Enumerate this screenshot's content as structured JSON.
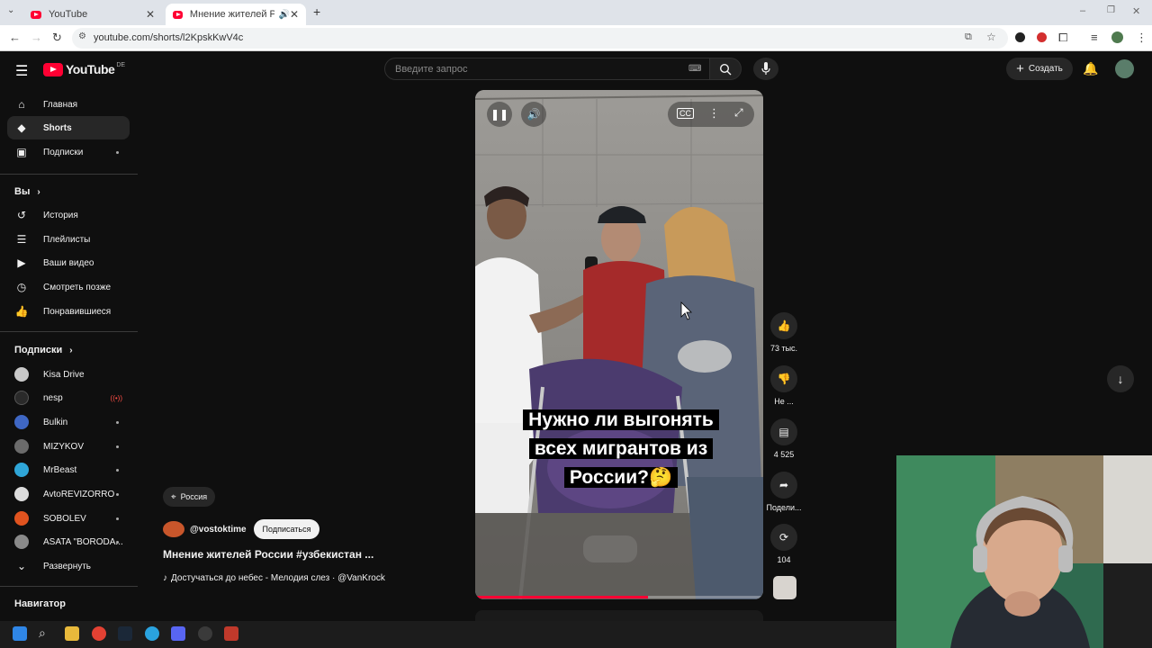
{
  "browser": {
    "tabs": [
      {
        "title": "YouTube",
        "active": false
      },
      {
        "title": "Мнение жителей России #узбекистан …",
        "active": true
      }
    ],
    "url": "youtube.com/shorts/l2KpskKwV4c"
  },
  "topbar": {
    "logo_text": "YouTube",
    "country_code": "DE",
    "search_placeholder": "Введите запрос",
    "create_label": "Создать"
  },
  "sidebar": {
    "main": [
      {
        "label": "Главная",
        "icon": "home-icon"
      },
      {
        "label": "Shorts",
        "icon": "shorts-icon",
        "active": true
      },
      {
        "label": "Подписки",
        "icon": "subscriptions-icon",
        "dot": true
      }
    ],
    "you_header": "Вы",
    "you": [
      {
        "label": "История",
        "icon": "history-icon"
      },
      {
        "label": "Плейлисты",
        "icon": "playlists-icon"
      },
      {
        "label": "Ваши видео",
        "icon": "your-videos-icon"
      },
      {
        "label": "Смотреть позже",
        "icon": "watch-later-icon"
      },
      {
        "label": "Понравившиеся",
        "icon": "liked-icon"
      }
    ],
    "subs_header": "Подписки",
    "subscriptions": [
      {
        "label": "Kisa Drive",
        "color": "#c9c9c9",
        "dot": false
      },
      {
        "label": "nesp",
        "color": "#2a2a2a",
        "live": true
      },
      {
        "label": "Bulkin",
        "color": "#3f67c4",
        "dot": true
      },
      {
        "label": "MIZYKOV",
        "color": "#6b6b6b",
        "dot": true
      },
      {
        "label": "MrBeast",
        "color": "#2fa6d8",
        "dot": true
      },
      {
        "label": "AvtoREVIZORRO",
        "color": "#dcdcdc",
        "dot": true
      },
      {
        "label": "SOBOLEV",
        "color": "#e0531f",
        "dot": true
      },
      {
        "label": "ASATA \"BORODA...",
        "color": "#8a8a8a",
        "dot": true
      }
    ],
    "expand_label": "Развернуть",
    "navigator_header": "Навигатор"
  },
  "short": {
    "location": "Россия",
    "channel": "@vostoktime",
    "subscribe_label": "Подписаться",
    "title": "Мнение жителей России #узбекистан ...",
    "music": "Достучаться до небес - Мелодия слез · @VanKrock",
    "caption": "Нужно ли выгонять всех мигрантов из России?🤔",
    "progress_fraction": 0.6
  },
  "actions": {
    "likes": "73 тыс.",
    "dislike": "Не ...",
    "comments": "4 525",
    "share": "Подели...",
    "remix": "104"
  },
  "colors": {
    "accent_red": "#ff0033",
    "bg": "#0f0f0f"
  }
}
